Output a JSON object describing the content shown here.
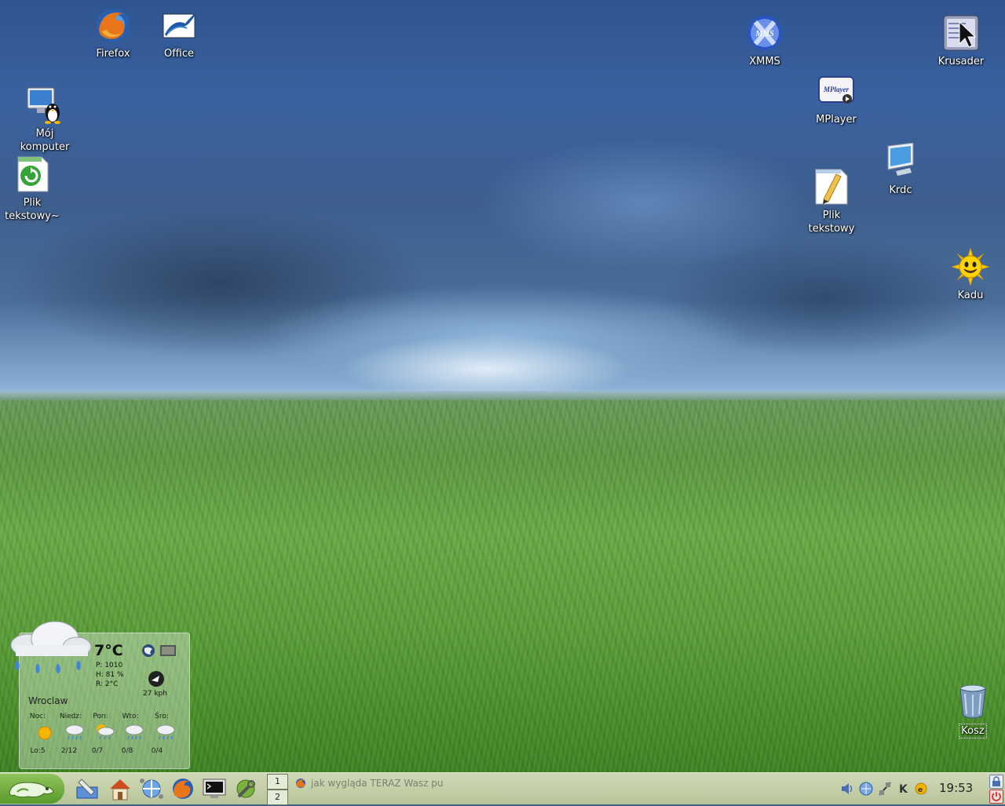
{
  "desktop": {
    "icons": [
      {
        "id": "firefox",
        "label": "Firefox",
        "icon": "firefox-icon"
      },
      {
        "id": "office",
        "label": "Office",
        "icon": "office-icon"
      },
      {
        "id": "computer",
        "label": "Mój\nkomputer",
        "icon": "computer-icon"
      },
      {
        "id": "textfile1",
        "label": "Plik\ntekstowy~",
        "icon": "text-file-icon"
      },
      {
        "id": "xmms",
        "label": "XMMS",
        "icon": "xmms-icon"
      },
      {
        "id": "krusader",
        "label": "Krusader",
        "icon": "krusader-icon"
      },
      {
        "id": "mplayer",
        "label": "MPlayer",
        "icon": "mplayer-icon"
      },
      {
        "id": "krdc",
        "label": "Krdc",
        "icon": "krdc-icon"
      },
      {
        "id": "textfile2",
        "label": "Plik\ntekstowy",
        "icon": "text-editor-icon"
      },
      {
        "id": "kadu",
        "label": "Kadu",
        "icon": "kadu-sun-icon"
      },
      {
        "id": "trash",
        "label": "Kosz",
        "icon": "trash-icon"
      }
    ]
  },
  "weather": {
    "temperature": "7°C",
    "pressure": "P: 1010",
    "humidity": "H: 81 %",
    "realfeel": "R: 2°C",
    "wind": "27 kph",
    "city": "Wroclaw",
    "forecast": [
      {
        "day": "Noc:",
        "value": "Lo:5",
        "icon": "sunny-icon"
      },
      {
        "day": "Niedz:",
        "value": "2/12",
        "icon": "rain-cloud-icon"
      },
      {
        "day": "Pon:",
        "value": "0/7",
        "icon": "sun-rain-icon"
      },
      {
        "day": "Wto:",
        "value": "0/8",
        "icon": "rain-cloud-icon"
      },
      {
        "day": "Śro:",
        "value": "0/4",
        "icon": "rain-cloud-icon"
      }
    ]
  },
  "taskbar": {
    "pager": [
      "1",
      "2"
    ],
    "task": "jak wygląda TERAZ Wasz pu",
    "clock": "19:53",
    "quick_launch": [
      "kde-desktop-icon",
      "home-icon",
      "network-icon",
      "firefox-icon",
      "terminal-icon",
      "settings-icon"
    ],
    "tray": [
      "volume-icon",
      "network-tray-icon",
      "connection-icon",
      "klipper-icon",
      "kde-tray-icon"
    ]
  }
}
